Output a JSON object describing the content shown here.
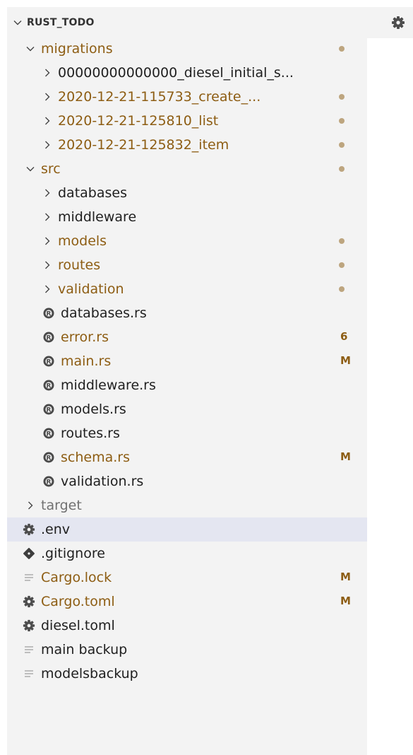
{
  "explorer": {
    "root": {
      "label": "RUST_TODO"
    },
    "items": [
      {
        "label": "migrations",
        "depth": 1,
        "type": "folder",
        "expanded": true,
        "status": "dot",
        "state": "modified"
      },
      {
        "label": "00000000000000_diesel_initial_s...",
        "depth": 2,
        "type": "folder",
        "expanded": false,
        "state": "normal"
      },
      {
        "label": "2020-12-21-115733_create_...",
        "depth": 2,
        "type": "folder",
        "expanded": false,
        "status": "dot",
        "state": "modified"
      },
      {
        "label": "2020-12-21-125810_list",
        "depth": 2,
        "type": "folder",
        "expanded": false,
        "status": "dot",
        "state": "modified"
      },
      {
        "label": "2020-12-21-125832_item",
        "depth": 2,
        "type": "folder",
        "expanded": false,
        "status": "dot",
        "state": "modified"
      },
      {
        "label": "src",
        "depth": 1,
        "type": "folder",
        "expanded": true,
        "status": "dot",
        "state": "modified"
      },
      {
        "label": "databases",
        "depth": 2,
        "type": "folder",
        "expanded": false,
        "state": "normal"
      },
      {
        "label": "middleware",
        "depth": 2,
        "type": "folder",
        "expanded": false,
        "state": "normal"
      },
      {
        "label": "models",
        "depth": 2,
        "type": "folder",
        "expanded": false,
        "status": "dot",
        "state": "modified"
      },
      {
        "label": "routes",
        "depth": 2,
        "type": "folder",
        "expanded": false,
        "status": "dot",
        "state": "modified"
      },
      {
        "label": "validation",
        "depth": 2,
        "type": "folder",
        "expanded": false,
        "status": "dot",
        "state": "modified"
      },
      {
        "label": "databases.rs",
        "depth": 2,
        "type": "file",
        "icon": "rust-icon",
        "state": "normal"
      },
      {
        "label": "error.rs",
        "depth": 2,
        "type": "file",
        "icon": "rust-icon",
        "status": "6",
        "state": "modified"
      },
      {
        "label": "main.rs",
        "depth": 2,
        "type": "file",
        "icon": "rust-icon",
        "status": "M",
        "state": "modified"
      },
      {
        "label": "middleware.rs",
        "depth": 2,
        "type": "file",
        "icon": "rust-icon",
        "state": "normal"
      },
      {
        "label": "models.rs",
        "depth": 2,
        "type": "file",
        "icon": "rust-icon",
        "state": "normal"
      },
      {
        "label": "routes.rs",
        "depth": 2,
        "type": "file",
        "icon": "rust-icon",
        "state": "normal"
      },
      {
        "label": "schema.rs",
        "depth": 2,
        "type": "file",
        "icon": "rust-icon",
        "status": "M",
        "state": "modified"
      },
      {
        "label": "validation.rs",
        "depth": 2,
        "type": "file",
        "icon": "rust-icon",
        "state": "normal"
      },
      {
        "label": "target",
        "depth": 1,
        "type": "folder",
        "expanded": false,
        "state": "ignored"
      },
      {
        "label": ".env",
        "depth": 0,
        "type": "file",
        "icon": "gear-icon",
        "state": "normal",
        "selected": true
      },
      {
        "label": ".gitignore",
        "depth": 0,
        "type": "file",
        "icon": "git-icon",
        "state": "normal"
      },
      {
        "label": "Cargo.lock",
        "depth": 0,
        "type": "file",
        "icon": "lines-icon",
        "status": "M",
        "state": "modified"
      },
      {
        "label": "Cargo.toml",
        "depth": 0,
        "type": "file",
        "icon": "gear-icon",
        "status": "M",
        "state": "modified"
      },
      {
        "label": "diesel.toml",
        "depth": 0,
        "type": "file",
        "icon": "gear-icon",
        "state": "normal"
      },
      {
        "label": "main backup",
        "depth": 0,
        "type": "file",
        "icon": "lines-icon",
        "state": "normal"
      },
      {
        "label": "modelsbackup",
        "depth": 0,
        "type": "file",
        "icon": "lines-icon",
        "state": "normal"
      }
    ]
  },
  "editor": {
    "tab_icon": "gear-icon"
  },
  "colors": {
    "sidebar_bg": "#f3f3f3",
    "selected_bg": "#e4e6f1",
    "modified_text": "#8d5d13",
    "status_dot": "#bda57f",
    "ignored_text": "#717171",
    "text": "#1f1f1f"
  }
}
